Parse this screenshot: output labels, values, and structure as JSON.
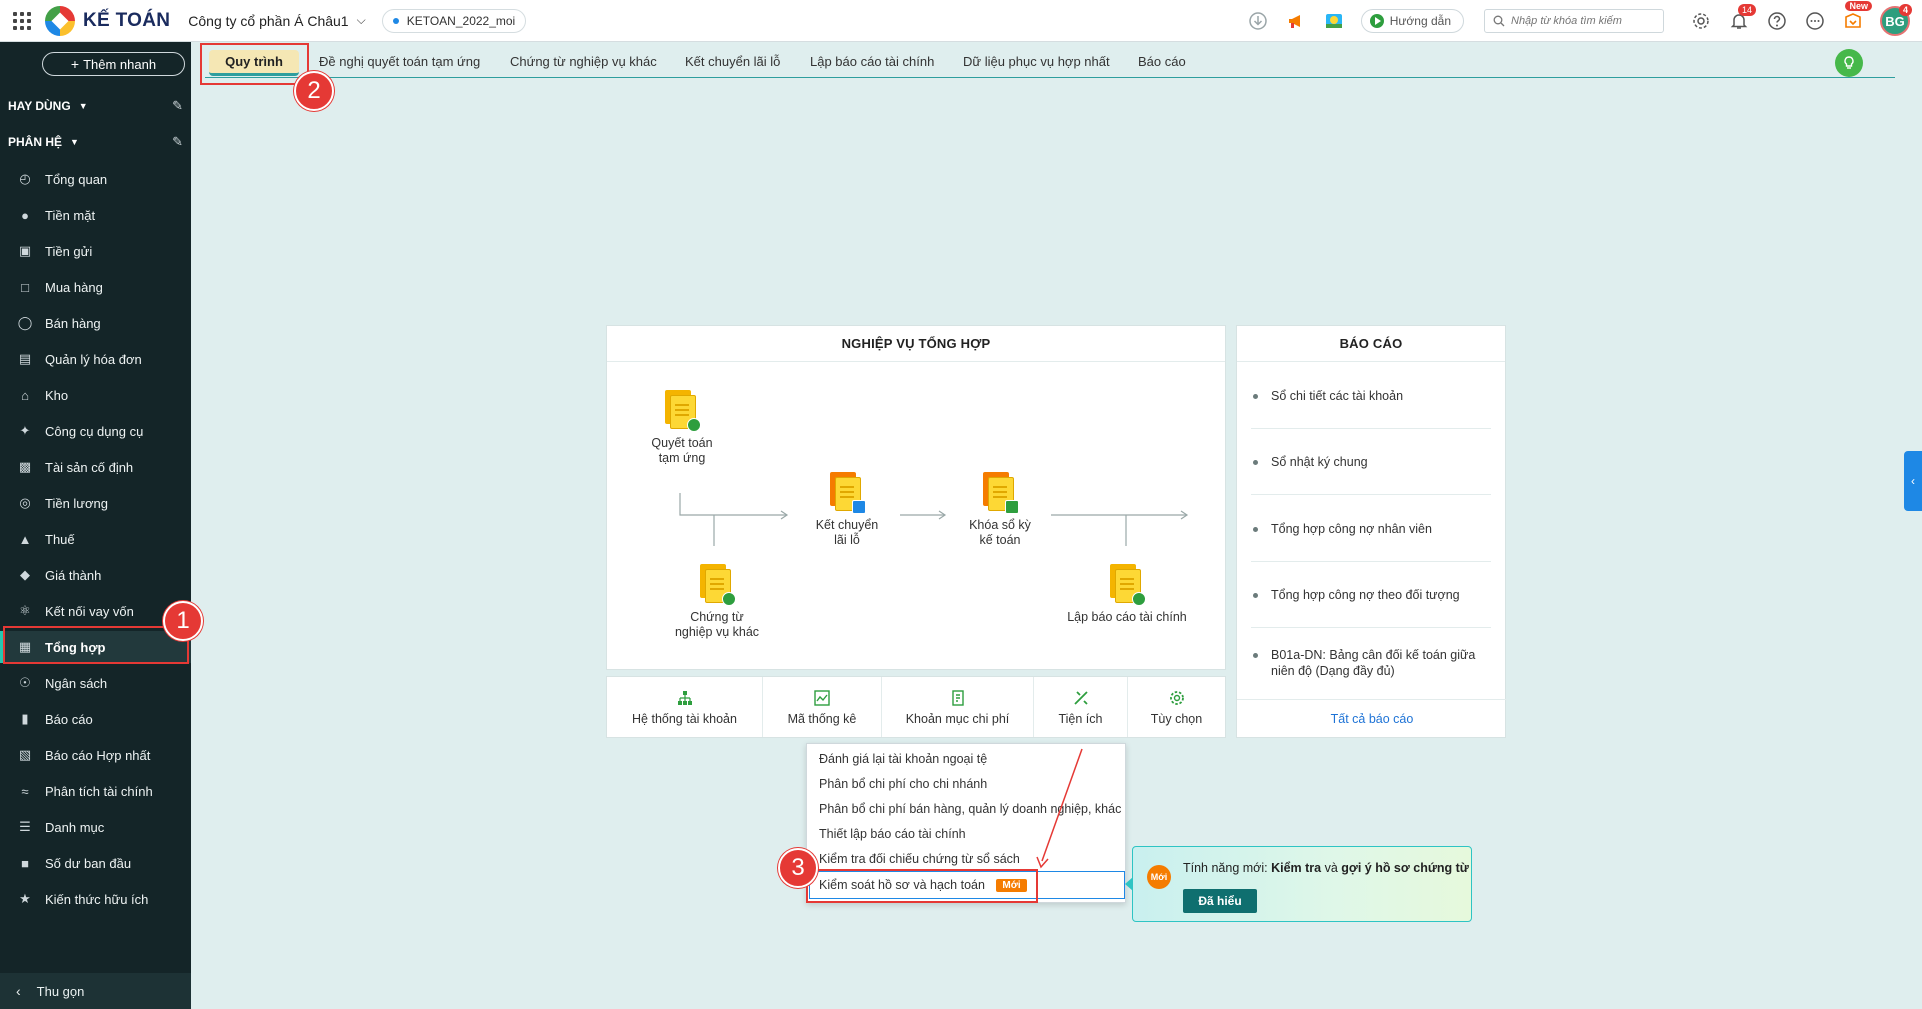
{
  "app": {
    "logo_text": "KẾ TOÁN",
    "company": "Công ty cổ phần Á Châu1",
    "database": "KETOAN_2022_moi"
  },
  "topbar": {
    "guide_label": "Hướng dẫn",
    "search_placeholder": "Nhập từ khóa tìm kiếm",
    "notification_count": "14",
    "new_badge": "New",
    "avatar_initials": "BG",
    "avatar_badge": "4"
  },
  "sidebar": {
    "quick_add": "Thêm nhanh",
    "section_favorites": "HAY DÙNG",
    "section_modules": "PHÂN HỆ",
    "items": [
      {
        "label": "Tổng quan",
        "icon": "dashboard-icon"
      },
      {
        "label": "Tiền mặt",
        "icon": "money-bag-icon"
      },
      {
        "label": "Tiền gửi",
        "icon": "bank-icon"
      },
      {
        "label": "Mua hàng",
        "icon": "shopping-bag-icon"
      },
      {
        "label": "Bán hàng",
        "icon": "cart-icon"
      },
      {
        "label": "Quản lý hóa đơn",
        "icon": "invoice-icon"
      },
      {
        "label": "Kho",
        "icon": "warehouse-icon"
      },
      {
        "label": "Công cụ dụng cụ",
        "icon": "tools-icon"
      },
      {
        "label": "Tài sản cố định",
        "icon": "car-icon"
      },
      {
        "label": "Tiền lương",
        "icon": "salary-icon"
      },
      {
        "label": "Thuế",
        "icon": "tax-icon"
      },
      {
        "label": "Giá thành",
        "icon": "price-tag-icon"
      },
      {
        "label": "Kết nối vay vốn",
        "icon": "loan-icon"
      },
      {
        "label": "Tổng hợp",
        "icon": "ledger-icon"
      },
      {
        "label": "Ngân sách",
        "icon": "budget-icon"
      },
      {
        "label": "Báo cáo",
        "icon": "bar-chart-icon"
      },
      {
        "label": "Báo cáo Hợp nhất",
        "icon": "consolidated-report-icon"
      },
      {
        "label": "Phân tích tài chính",
        "icon": "line-chart-icon"
      },
      {
        "label": "Danh mục",
        "icon": "list-icon"
      },
      {
        "label": "Số dư ban đầu",
        "icon": "balance-icon"
      },
      {
        "label": "Kiến thức hữu ích",
        "icon": "knowledge-icon"
      }
    ],
    "active_index": 13,
    "collapse_label": "Thu gọn"
  },
  "tabs": [
    "Quy trình",
    "Đề nghị quyết toán tạm ứng",
    "Chứng từ nghiệp vụ khác",
    "Kết chuyển lãi lỗ",
    "Lập báo cáo tài chính",
    "Dữ liệu phục vụ hợp nhất",
    "Báo cáo"
  ],
  "workflow": {
    "title": "NGHIỆP VỤ TỔNG HỢP",
    "nodes": {
      "advance_settlement": [
        "Quyết toán",
        "tạm ứng"
      ],
      "other_vouchers": [
        "Chứng từ",
        "nghiệp vụ khác"
      ],
      "profit_transfer": [
        "Kết chuyển",
        "lãi lỗ"
      ],
      "lock_books": [
        "Khóa sổ kỳ",
        "kế toán"
      ],
      "financial_report": [
        "Lập báo cáo tài chính"
      ]
    }
  },
  "tools": [
    {
      "label": "Hệ thống tài khoản",
      "icon": "account-tree-icon"
    },
    {
      "label": "Mã thống kê",
      "icon": "statistics-icon"
    },
    {
      "label": "Khoản mục chi phí",
      "icon": "expense-icon"
    },
    {
      "label": "Tiện ích",
      "icon": "utility-icon"
    },
    {
      "label": "Tùy chọn",
      "icon": "gear-icon"
    }
  ],
  "reports": {
    "title": "BÁO CÁO",
    "items": [
      "Sổ chi tiết các tài khoản",
      "Sổ nhật ký chung",
      "Tổng hợp công nợ nhân viên",
      "Tổng hợp công nợ theo đối tượng",
      "B01a-DN: Bảng cân đối kế toán giữa niên độ (Dạng đầy đủ)"
    ],
    "all_link": "Tất cả báo cáo"
  },
  "utility_menu": {
    "items": [
      "Đánh giá lại tài khoản ngoại tệ",
      "Phân bổ chi phí cho chi nhánh",
      "Phân bổ chi phí bán hàng, quản lý doanh nghiệp, khác",
      "Thiết lập báo cáo tài chính",
      "Kiểm tra đối chiếu chứng từ sổ sách",
      "Kiểm soát hồ sơ và hạch toán"
    ],
    "new_tag": "Mới"
  },
  "tooltip": {
    "badge": "Mới",
    "text_prefix": "Tính năng mới: ",
    "text_bold1": "Kiểm tra",
    "text_mid": " và ",
    "text_bold2": "gợi ý hồ sơ chứng từ",
    "button": "Đã hiểu"
  },
  "annotations": [
    "1",
    "2",
    "3"
  ],
  "colors": {
    "sidebar_bg": "#142528",
    "content_bg": "#dfeeee",
    "accent_teal": "#2e9e9e",
    "highlight_red": "#e53935",
    "new_orange": "#f57c00"
  }
}
